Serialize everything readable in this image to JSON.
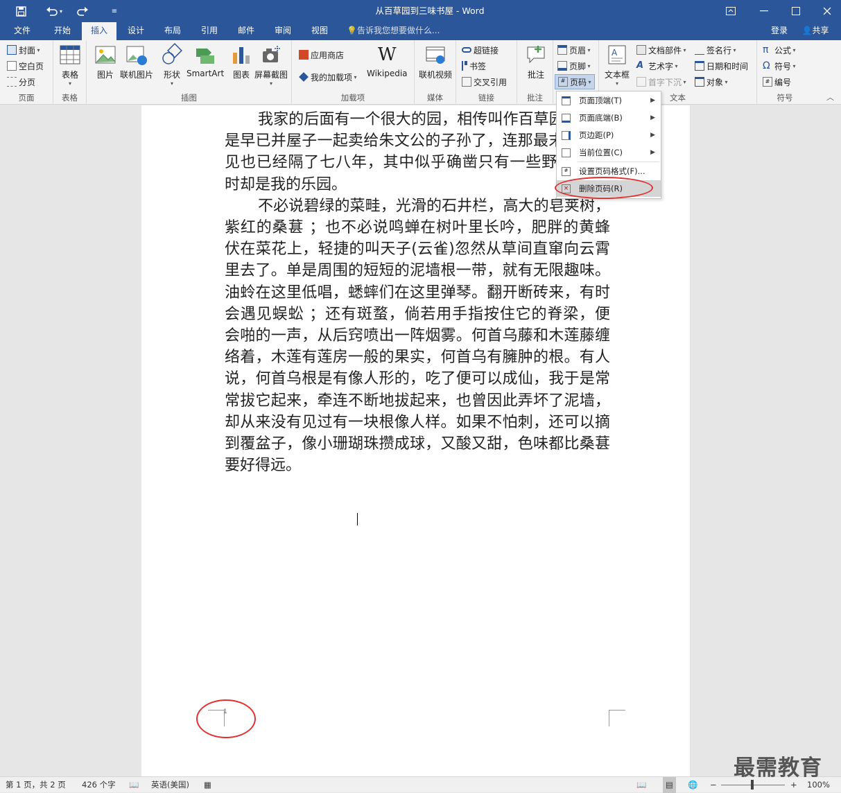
{
  "titlebar": {
    "title": "从百草园到三味书屋 - Word"
  },
  "tabs": {
    "file": "文件",
    "home": "开始",
    "insert": "插入",
    "design": "设计",
    "layout": "布局",
    "references": "引用",
    "mailings": "邮件",
    "review": "审阅",
    "view": "视图",
    "tell": "告诉我您想要做什么...",
    "signin": "登录",
    "share": "共享"
  },
  "ribbon": {
    "pages": {
      "cover": "封面",
      "blank": "空白页",
      "break": "分页",
      "label": "页面"
    },
    "tables": {
      "table": "表格",
      "label": "表格"
    },
    "illustrations": {
      "picture": "图片",
      "online_picture": "联机图片",
      "shapes": "形状",
      "smartart": "SmartArt",
      "chart": "图表",
      "screenshot": "屏幕截图",
      "label": "插图"
    },
    "addins": {
      "store": "应用商店",
      "myaddins": "我的加载项",
      "wikipedia": "Wikipedia",
      "label": "加载项"
    },
    "media": {
      "online_video": "联机视频",
      "label": "媒体"
    },
    "links": {
      "hyperlink": "超链接",
      "bookmark": "书签",
      "crossref": "交叉引用",
      "label": "链接"
    },
    "comments": {
      "comment": "批注",
      "label": "批注"
    },
    "header_footer": {
      "header": "页眉",
      "footer": "页脚",
      "page_number": "页码"
    },
    "text": {
      "textbox": "文本框",
      "quickparts": "文档部件",
      "wordart": "艺术字",
      "dropcap": "首字下沉",
      "signature": "签名行",
      "datetime": "日期和时间",
      "object": "对象",
      "label": "文本"
    },
    "symbols": {
      "equation": "公式",
      "symbol": "符号",
      "number": "编号",
      "label": "符号"
    }
  },
  "dropdown": {
    "items": [
      "页面顶端(T)",
      "页面底端(B)",
      "页边距(P)",
      "当前位置(C)",
      "设置页码格式(F)...",
      "删除页码(R)"
    ]
  },
  "document": {
    "paragraphs": [
      "我家的后面有一个很大的园，相传叫作百草园。现在是早已并屋子一起卖给朱文公的子孙了，连那最末次的相见也已经隔了七八年，其中似乎确凿只有一些野草;但那时却是我的乐园。",
      "不必说碧绿的菜畦，光滑的石井栏，高大的皂荚树，紫红的桑葚 ；也不必说鸣蝉在树叶里长吟，肥胖的黄蜂伏在菜花上，轻捷的叫天子(云雀)忽然从草间直窜向云霄里去了。单是周围的短短的泥墙根一带，就有无限趣味。油蛉在这里低唱，蟋蟀们在这里弹琴。翻开断砖来，有时会遇见蜈蚣 ；还有斑蝥，倘若用手指按住它的脊梁，便会啪的一声，从后窍喷出一阵烟雾。何首乌藤和木莲藤缠络着，木莲有莲房一般的果实，何首乌有臃肿的根。有人说，何首乌根是有像人形的，吃了便可以成仙，我于是常常拔它起来，牵连不断地拔起来，也曾因此弄坏了泥墙，却从来没有见过有一块根像人样。如果不怕刺，还可以摘到覆盆子，像小珊瑚珠攒成球，又酸又甜，色味都比桑葚要好得远。"
    ],
    "page_number": "1"
  },
  "status": {
    "page": "第 1 页，共 2 页",
    "words": "426 个字",
    "language": "英语(美国)",
    "zoom": "100%"
  },
  "watermark": "最需教育",
  "colors": {
    "accent": "#2b579a",
    "highlight_circle": "#e03030"
  }
}
